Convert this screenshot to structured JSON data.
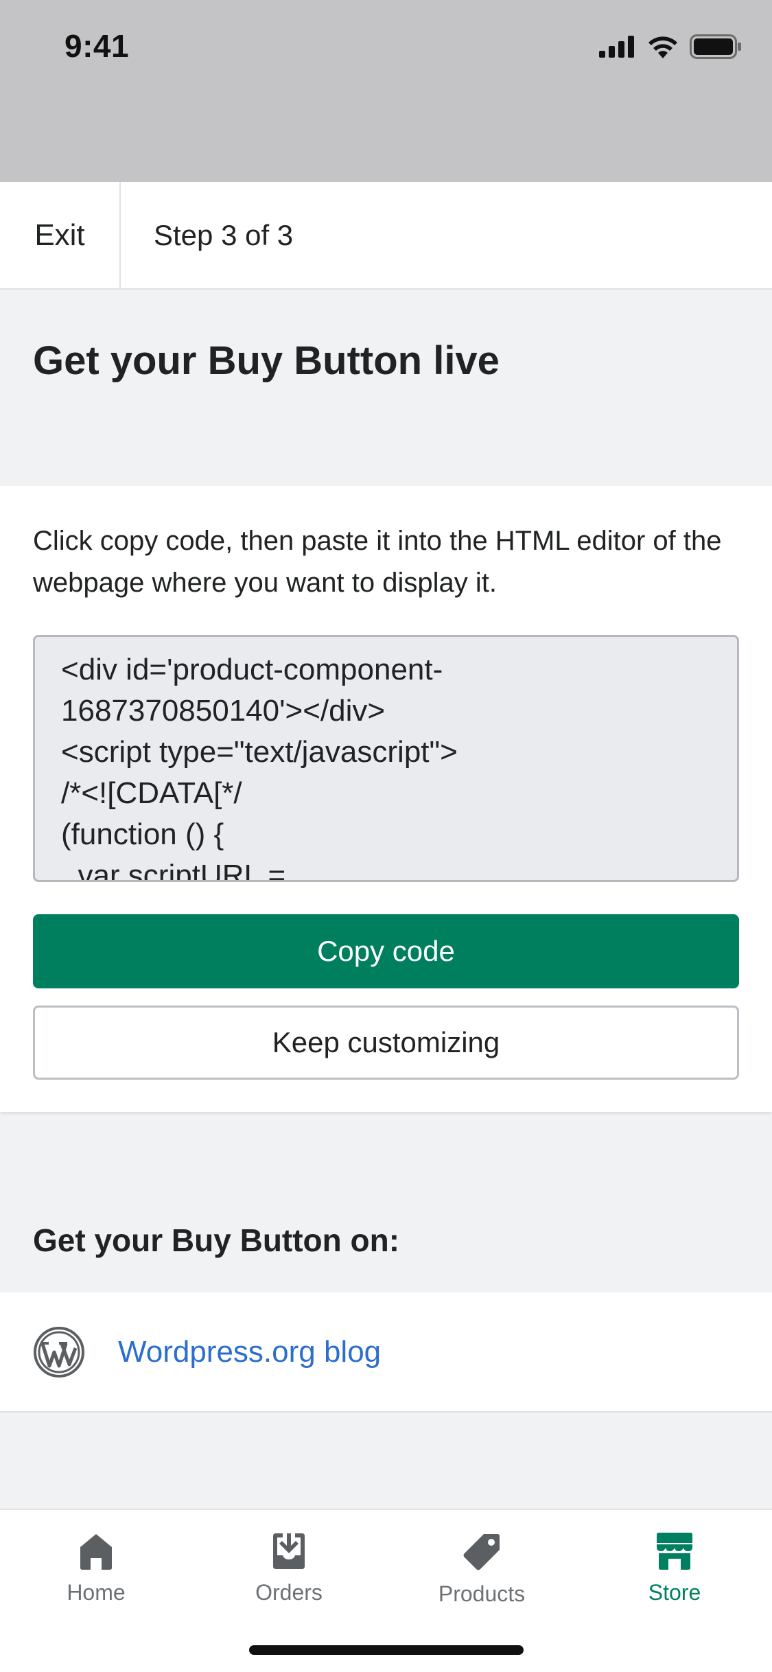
{
  "status_bar": {
    "time": "9:41"
  },
  "header": {
    "exit_label": "Exit",
    "step_label": "Step 3 of 3"
  },
  "page": {
    "title": "Get your Buy Button live"
  },
  "code_section": {
    "instructions": "Click copy code, then paste it into the HTML editor of the webpage where you want to display it.",
    "code_lines": [
      "<div id='product-component-",
      "1687370850140'></div>",
      "<script type=\"text/javascript\">",
      "/*<![CDATA[*/",
      "(function () {",
      "  var scriptURL ="
    ],
    "copy_label": "Copy code",
    "keep_label": "Keep customizing"
  },
  "platforms": {
    "heading": "Get your Buy Button on:",
    "items": [
      {
        "label": "Wordpress.org blog",
        "icon": "wordpress-icon"
      }
    ]
  },
  "tab_bar": {
    "tabs": [
      {
        "label": "Home",
        "icon": "home-icon"
      },
      {
        "label": "Orders",
        "icon": "orders-icon"
      },
      {
        "label": "Products",
        "icon": "tag-icon"
      },
      {
        "label": "Store",
        "icon": "store-icon",
        "active": true
      }
    ]
  },
  "colors": {
    "primary": "#007f5f",
    "link": "#2c6ecb",
    "active_tab": "#008060",
    "inactive_tab": "#6d7175"
  }
}
